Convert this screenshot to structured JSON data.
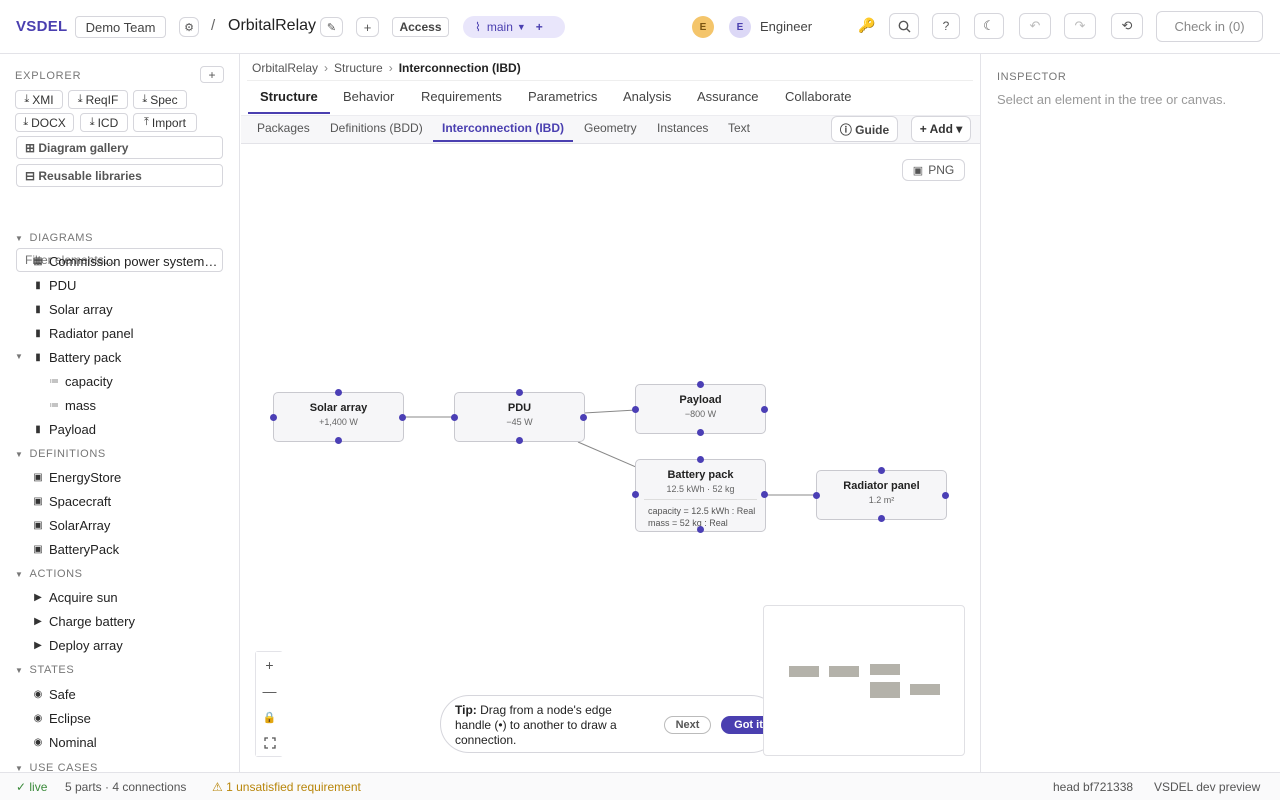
{
  "header": {
    "brand": "VSDEL",
    "team": "Demo Team",
    "separator": "/",
    "project": "OrbitalRelay",
    "access_label": "Access",
    "branch": "main",
    "branch_icon": "⌇",
    "user_initial_1": "E",
    "user_initial_2": "E",
    "user_role": "Engineer",
    "checkin_label": "Check in (0)",
    "colors": {
      "brand": "#4a3fb0",
      "branch_bg": "#e9e6fb",
      "avatar_orange": "#f4c56b",
      "avatar_purple": "#dcd8f6"
    }
  },
  "explorer": {
    "title": "EXPLORER",
    "add_symbol": "+",
    "exports": [
      {
        "label": "XMI",
        "icon": "download-icon"
      },
      {
        "label": "ReqIF",
        "icon": "download-icon"
      },
      {
        "label": "Spec",
        "icon": "download-icon"
      },
      {
        "label": "DOCX",
        "icon": "download-icon"
      },
      {
        "label": "ICD",
        "icon": "download-icon"
      },
      {
        "label": "Import",
        "icon": "upload-icon"
      }
    ],
    "gallery_label": "⊞ Diagram gallery",
    "libraries_label": "⊟ Reusable libraries",
    "filter_placeholder": "Filter elements…",
    "sections": {
      "diagrams": "DIAGRAMS",
      "definitions": "DEFINITIONS",
      "actions": "ACTIONS",
      "states": "STATES",
      "use_cases": "USE CASES"
    },
    "diagrams": [
      "Commission power system…",
      "PDU",
      "Solar array",
      "Radiator panel",
      "Battery pack",
      "capacity",
      "mass",
      "Payload"
    ],
    "definitions": [
      "EnergyStore",
      "Spacecraft",
      "SolarArray",
      "BatteryPack"
    ],
    "actions": [
      "Acquire sun",
      "Charge battery",
      "Deploy array"
    ],
    "states": [
      "Safe",
      "Eclipse",
      "Nominal"
    ]
  },
  "breadcrumb": [
    "OrbitalRelay",
    "Structure",
    "Interconnection (IBD)"
  ],
  "tabs": [
    "Structure",
    "Behavior",
    "Requirements",
    "Parametrics",
    "Analysis",
    "Assurance",
    "Collaborate"
  ],
  "subtabs": [
    "Packages",
    "Definitions (BDD)",
    "Interconnection (IBD)",
    "Geometry",
    "Instances",
    "Text"
  ],
  "guide_label": "ⓘ Guide",
  "add_label": "+ Add ▾",
  "png_label": "PNG",
  "nodes": [
    {
      "title": "Solar array",
      "sub": "+1,400 W"
    },
    {
      "title": "PDU",
      "sub": "−45 W"
    },
    {
      "title": "Payload",
      "sub": "−800 W"
    },
    {
      "title": "Battery pack",
      "sub": "12.5 kWh · 52 kg",
      "attr1": "capacity = 12.5 kWh : Real",
      "attr2": "mass = 52 kg : Real"
    },
    {
      "title": "Radiator panel",
      "sub": "1.2 m²"
    }
  ],
  "tip": {
    "bold": "Tip:",
    "text": "Drag from a node's edge handle (•) to another to draw a connection.",
    "next": "Next",
    "gotit": "Got it"
  },
  "inspector": {
    "title": "INSPECTOR",
    "hint": "Select an element in the tree or canvas."
  },
  "status": {
    "live": "✓ live",
    "counts": "5 parts · 4 connections",
    "warning": "⚠ 1 unsatisfied requirement",
    "head": "head bf721338",
    "env": "VSDEL dev preview"
  }
}
